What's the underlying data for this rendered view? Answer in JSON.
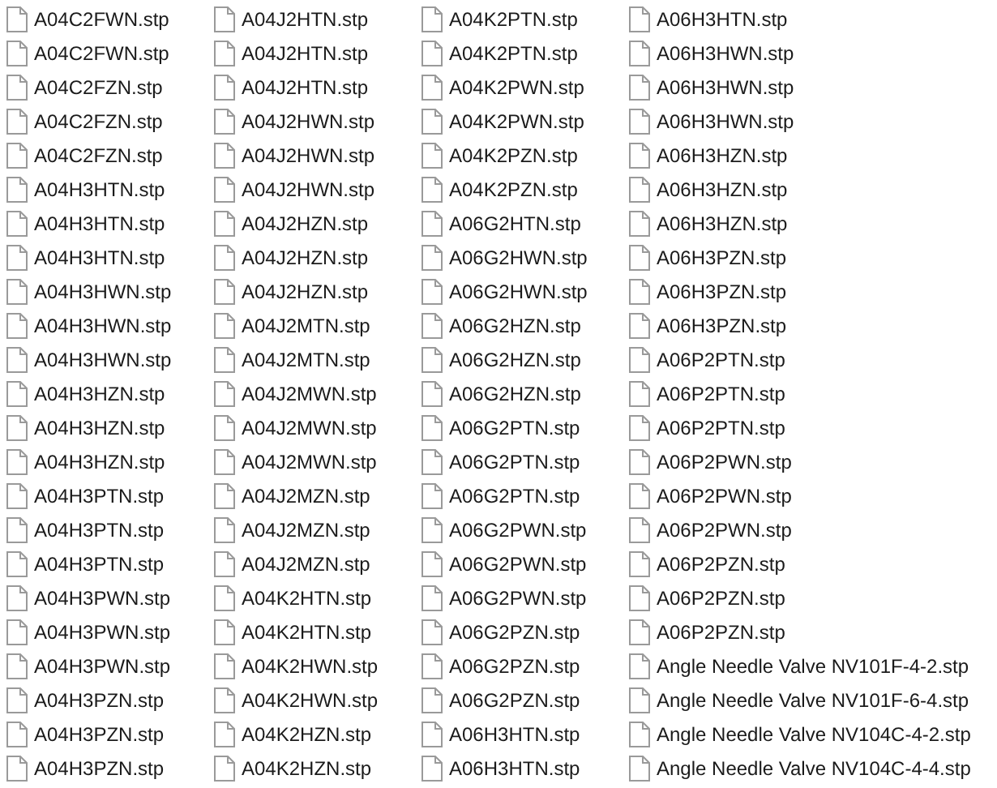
{
  "columns": [
    {
      "files": [
        "A04C2FWN.stp",
        "A04C2FWN.stp",
        "A04C2FZN.stp",
        "A04C2FZN.stp",
        "A04C2FZN.stp",
        "A04H3HTN.stp",
        "A04H3HTN.stp",
        "A04H3HTN.stp",
        "A04H3HWN.stp",
        "A04H3HWN.stp",
        "A04H3HWN.stp",
        "A04H3HZN.stp",
        "A04H3HZN.stp",
        "A04H3HZN.stp",
        "A04H3PTN.stp",
        "A04H3PTN.stp",
        "A04H3PTN.stp",
        "A04H3PWN.stp",
        "A04H3PWN.stp",
        "A04H3PWN.stp",
        "A04H3PZN.stp",
        "A04H3PZN.stp",
        "A04H3PZN.stp"
      ]
    },
    {
      "files": [
        "A04J2HTN.stp",
        "A04J2HTN.stp",
        "A04J2HTN.stp",
        "A04J2HWN.stp",
        "A04J2HWN.stp",
        "A04J2HWN.stp",
        "A04J2HZN.stp",
        "A04J2HZN.stp",
        "A04J2HZN.stp",
        "A04J2MTN.stp",
        "A04J2MTN.stp",
        "A04J2MWN.stp",
        "A04J2MWN.stp",
        "A04J2MWN.stp",
        "A04J2MZN.stp",
        "A04J2MZN.stp",
        "A04J2MZN.stp",
        "A04K2HTN.stp",
        "A04K2HTN.stp",
        "A04K2HWN.stp",
        "A04K2HWN.stp",
        "A04K2HZN.stp",
        "A04K2HZN.stp"
      ]
    },
    {
      "files": [
        "A04K2PTN.stp",
        "A04K2PTN.stp",
        "A04K2PWN.stp",
        "A04K2PWN.stp",
        "A04K2PZN.stp",
        "A04K2PZN.stp",
        "A06G2HTN.stp",
        "A06G2HWN.stp",
        "A06G2HWN.stp",
        "A06G2HZN.stp",
        "A06G2HZN.stp",
        "A06G2HZN.stp",
        "A06G2PTN.stp",
        "A06G2PTN.stp",
        "A06G2PTN.stp",
        "A06G2PWN.stp",
        "A06G2PWN.stp",
        "A06G2PWN.stp",
        "A06G2PZN.stp",
        "A06G2PZN.stp",
        "A06G2PZN.stp",
        "A06H3HTN.stp",
        "A06H3HTN.stp"
      ]
    },
    {
      "files": [
        "A06H3HTN.stp",
        "A06H3HWN.stp",
        "A06H3HWN.stp",
        "A06H3HWN.stp",
        "A06H3HZN.stp",
        "A06H3HZN.stp",
        "A06H3HZN.stp",
        "A06H3PZN.stp",
        "A06H3PZN.stp",
        "A06H3PZN.stp",
        "A06P2PTN.stp",
        "A06P2PTN.stp",
        "A06P2PTN.stp",
        "A06P2PWN.stp",
        "A06P2PWN.stp",
        "A06P2PWN.stp",
        "A06P2PZN.stp",
        "A06P2PZN.stp",
        "A06P2PZN.stp",
        "Angle Needle Valve NV101F-4-2.stp",
        "Angle Needle Valve NV101F-6-4.stp",
        "Angle Needle Valve NV104C-4-2.stp",
        "Angle Needle Valve NV104C-4-4.stp"
      ]
    }
  ]
}
